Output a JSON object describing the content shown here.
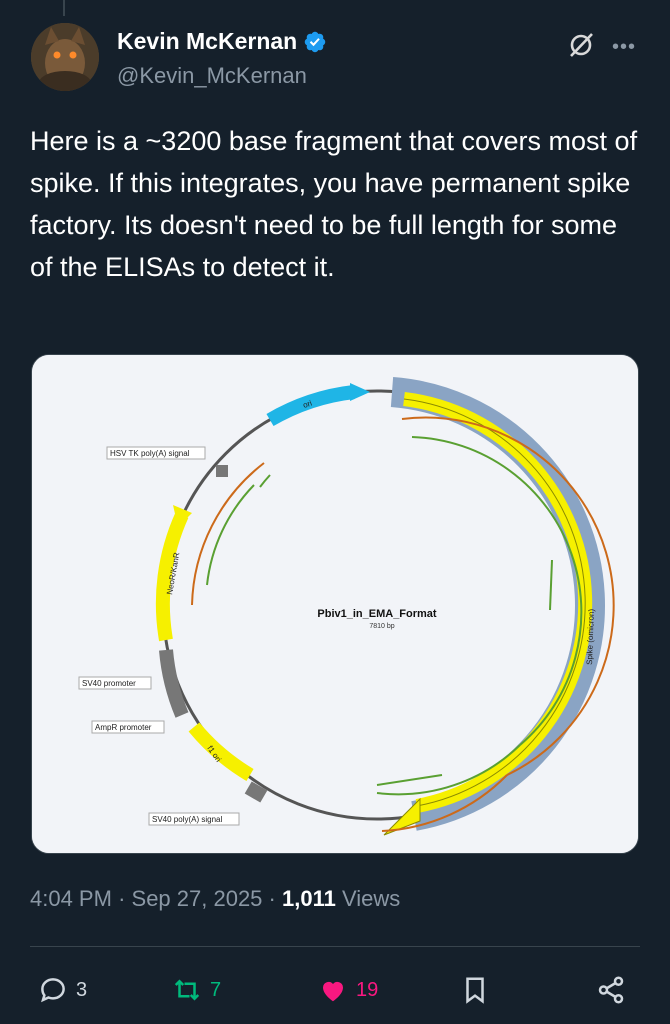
{
  "tweet": {
    "author_name": "Kevin McKernan",
    "author_handle": "@Kevin_McKernan",
    "text": "Here is a ~3200 base fragment that covers most of spike. If this integrates, you have permanent spike factory. Its doesn't need to be full length for some of the ELISAs to detect it.",
    "time": "4:04 PM",
    "date": "Sep 27, 2025",
    "views_count": "1,011",
    "views_label": "Views"
  },
  "map": {
    "title": "Pbiv1_in_EMA_Format",
    "size": "7810 bp",
    "features": {
      "ori": "ori",
      "hsv": "HSV TK poly(A) signal",
      "neo": "NeoR/KanR",
      "sv40_promoter": "SV40 promoter",
      "ampr_promoter": "AmpR promoter",
      "f1_ori": "f1 ori",
      "sv40_polya": "SV40 poly(A) signal",
      "spike": "Spike (omicron)"
    }
  },
  "actions": {
    "replies": "3",
    "retweets": "7",
    "likes": "19"
  },
  "colors": {
    "background": "#15202b",
    "verified": "#1d9bf0",
    "retweet": "#00ba7c",
    "like": "#f91880",
    "muted": "#8b98a5"
  },
  "icons": [
    "verified-badge-icon",
    "grok-icon",
    "more-icon",
    "reply-icon",
    "retweet-icon",
    "like-icon",
    "bookmark-icon",
    "share-icon"
  ]
}
